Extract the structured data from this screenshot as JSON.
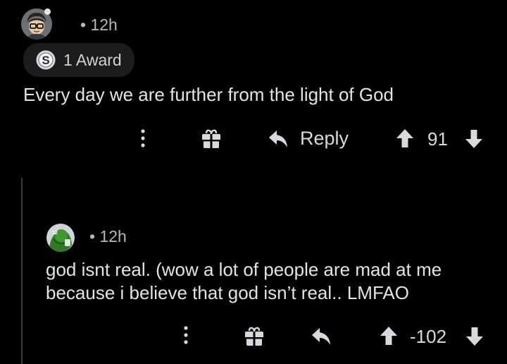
{
  "comments": [
    {
      "meta": "• 12h",
      "award": {
        "label": "1 Award",
        "icon": "silver-award-icon"
      },
      "body": "Every day we are further from the light of God",
      "actions": {
        "more_icon": "more-vertical-icon",
        "gift_icon": "gift-award-icon",
        "reply_icon": "reply-arrow-icon",
        "reply_label": "Reply",
        "score": "91"
      }
    },
    {
      "meta": "• 12h",
      "body_lines": [
        "god isnt real. (wow a lot of people are mad at me",
        "because i believe that god isn’t real.. LMFAO"
      ],
      "actions": {
        "more_icon": "more-vertical-icon",
        "gift_icon": "gift-award-icon",
        "reply_icon": "reply-arrow-icon",
        "score": "-102"
      }
    }
  ],
  "colors": {
    "background": "#000000",
    "text": "#d7dadc",
    "meta": "#b6b9bb",
    "award_pill": "#1c1c1d",
    "thread_line": "#3a3b3c"
  }
}
